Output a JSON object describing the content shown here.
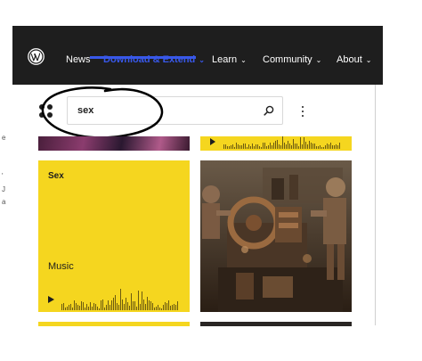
{
  "nav": {
    "items": [
      {
        "label": "News",
        "dropdown": false,
        "active": false
      },
      {
        "label": "Download & Extend",
        "dropdown": true,
        "active": true
      },
      {
        "label": "Learn",
        "dropdown": true,
        "active": false
      },
      {
        "label": "Community",
        "dropdown": true,
        "active": false
      },
      {
        "label": "About",
        "dropdown": true,
        "active": false
      }
    ],
    "chevron": "⌄",
    "logo_icon": "wordpress-logo-icon",
    "accent": "#3858e9",
    "background": "#1e1e1e"
  },
  "search": {
    "value": "sex",
    "icon": "search-icon",
    "filter_icon": "grid-dots-icon",
    "more_icon": "kebab-menu-icon"
  },
  "results": {
    "cards": [
      {
        "title": "Sex",
        "genre": "Music",
        "color": "#f5d61f",
        "icon": "play-icon"
      },
      {
        "image": "photo of rusted steampunk robots working in a machine workshop"
      }
    ]
  },
  "annotation": {
    "shape": "hand-drawn circle",
    "color": "#000000"
  }
}
